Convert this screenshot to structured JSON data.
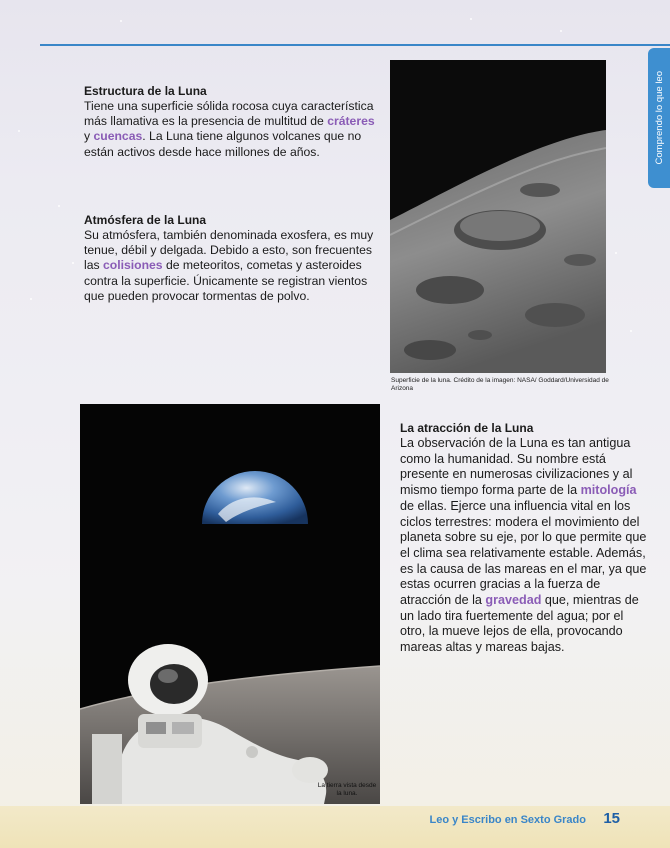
{
  "side_tab": {
    "label": "Comprendo lo que leo"
  },
  "sections": {
    "estructura": {
      "title": "Estructura de la Luna",
      "text_1": "Tiene una superficie sólida rocosa cuya característica más llamativa es la presencia de multitud de ",
      "highlight_1": "cráteres",
      "text_2": " y ",
      "highlight_2": "cuencas",
      "text_3": ". La Luna tiene algunos volcanes que no están activos desde hace millones de años."
    },
    "atmosfera": {
      "title": "Atmósfera de la Luna",
      "text_1": "Su atmósfera, también denominada exosfera, es muy tenue, débil y delgada. Debido a esto, son frecuentes las ",
      "highlight_1": "colisiones",
      "text_2": " de meteoritos, cometas y asteroides contra la superficie. Únicamente se registran vientos que pueden provocar tormentas de polvo."
    },
    "atraccion": {
      "title": "La atracción de la Luna",
      "text_1": "La observación de la Luna es tan antigua como la humanidad. Su nombre está presente en numerosas civilizaciones y al mismo tiempo forma parte de la ",
      "highlight_1": "mitología",
      "text_2": " de ellas. Ejerce una influencia vital en los ciclos terrestres: modera el movimiento del planeta sobre su eje, por lo que permite que el clima sea relativamente estable. Además, es la causa de las mareas en el mar, ya que estas ocurren gracias a la fuerza de atracción de la ",
      "highlight_2": "gravedad",
      "text_3": " que, mientras de un lado tira fuertemente del agua; por el otro, la mueve lejos de ella, provocando mareas altas y mareas bajas."
    }
  },
  "captions": {
    "moon": "Superficie de la luna. Crédito de la imagen: NASA/ Goddard/Universidad de Arizona",
    "earth": "La tierra vista desde la luna."
  },
  "footer": {
    "book_title": "Leo y Escribo en Sexto Grado",
    "page_number": "15"
  },
  "colors": {
    "accent_blue": "#3a86c8",
    "highlight_purple": "#8a5cb6",
    "footer_band": "#efe3b8"
  }
}
